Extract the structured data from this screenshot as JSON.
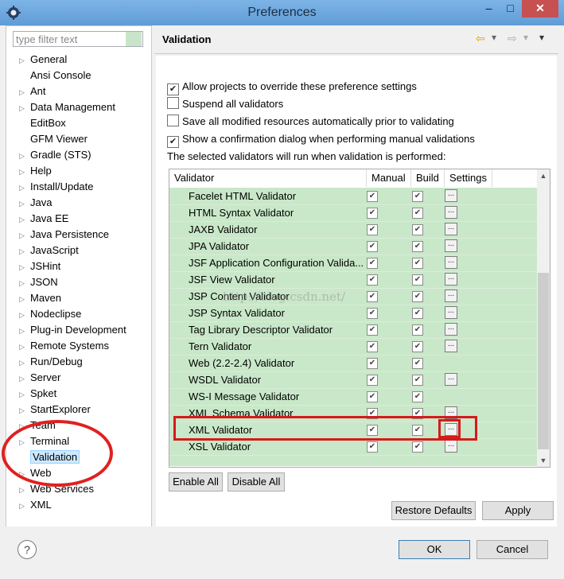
{
  "window": {
    "title": "Preferences",
    "minimize_label": "–",
    "maximize_label": "□",
    "close_label": "✕"
  },
  "filter": {
    "placeholder": "type filter text"
  },
  "tree": [
    {
      "label": "General",
      "arrow": "▷"
    },
    {
      "label": "Ansi Console",
      "arrow": ""
    },
    {
      "label": "Ant",
      "arrow": "▷"
    },
    {
      "label": "Data Management",
      "arrow": "▷"
    },
    {
      "label": "EditBox",
      "arrow": ""
    },
    {
      "label": "GFM Viewer",
      "arrow": ""
    },
    {
      "label": "Gradle (STS)",
      "arrow": "▷"
    },
    {
      "label": "Help",
      "arrow": "▷"
    },
    {
      "label": "Install/Update",
      "arrow": "▷"
    },
    {
      "label": "Java",
      "arrow": "▷"
    },
    {
      "label": "Java EE",
      "arrow": "▷"
    },
    {
      "label": "Java Persistence",
      "arrow": "▷"
    },
    {
      "label": "JavaScript",
      "arrow": "▷"
    },
    {
      "label": "JSHint",
      "arrow": "▷"
    },
    {
      "label": "JSON",
      "arrow": "▷"
    },
    {
      "label": "Maven",
      "arrow": "▷"
    },
    {
      "label": "Nodeclipse",
      "arrow": "▷"
    },
    {
      "label": "Plug-in Development",
      "arrow": "▷"
    },
    {
      "label": "Remote Systems",
      "arrow": "▷"
    },
    {
      "label": "Run/Debug",
      "arrow": "▷"
    },
    {
      "label": "Server",
      "arrow": "▷"
    },
    {
      "label": "Spket",
      "arrow": "▷"
    },
    {
      "label": "StartExplorer",
      "arrow": "▷"
    },
    {
      "label": "Team",
      "arrow": "▷"
    },
    {
      "label": "Terminal",
      "arrow": "▷"
    },
    {
      "label": "Validation",
      "arrow": ""
    },
    {
      "label": "Web",
      "arrow": "▷"
    },
    {
      "label": "Web Services",
      "arrow": "▷"
    },
    {
      "label": "XML",
      "arrow": "▷"
    }
  ],
  "page": {
    "title": "Validation",
    "back_icon": "⇦",
    "forward_icon": "⇨",
    "menu_icon": "▾",
    "options": [
      {
        "label": "Allow projects to override these preference settings",
        "checked": true
      },
      {
        "label": "Suspend all validators",
        "checked": false
      },
      {
        "label": "Save all modified resources automatically prior to validating",
        "checked": false
      },
      {
        "label": "Show a confirmation dialog when performing manual validations",
        "checked": true
      }
    ],
    "info": "The selected validators will run when validation is performed:",
    "columns": {
      "validator": "Validator",
      "manual": "Manual",
      "build": "Build",
      "settings": "Settings"
    },
    "validators": [
      {
        "name": "Facelet HTML Validator",
        "manual": true,
        "build": true,
        "settings": true
      },
      {
        "name": "HTML Syntax Validator",
        "manual": true,
        "build": true,
        "settings": true
      },
      {
        "name": "JAXB Validator",
        "manual": true,
        "build": true,
        "settings": true
      },
      {
        "name": "JPA Validator",
        "manual": true,
        "build": true,
        "settings": true
      },
      {
        "name": "JSF Application Configuration Valida...",
        "manual": true,
        "build": true,
        "settings": true
      },
      {
        "name": "JSF View Validator",
        "manual": true,
        "build": true,
        "settings": true
      },
      {
        "name": "JSP Content Validator",
        "manual": true,
        "build": true,
        "settings": true
      },
      {
        "name": "JSP Syntax Validator",
        "manual": true,
        "build": true,
        "settings": true
      },
      {
        "name": "Tag Library Descriptor Validator",
        "manual": true,
        "build": true,
        "settings": true
      },
      {
        "name": "Tern Validator",
        "manual": true,
        "build": true,
        "settings": true
      },
      {
        "name": "Web (2.2-2.4) Validator",
        "manual": true,
        "build": true,
        "settings": false
      },
      {
        "name": "WSDL Validator",
        "manual": true,
        "build": true,
        "settings": true
      },
      {
        "name": "WS-I Message Validator",
        "manual": true,
        "build": true,
        "settings": false
      },
      {
        "name": "XML Schema Validator",
        "manual": true,
        "build": true,
        "settings": true
      },
      {
        "name": "XML Validator",
        "manual": true,
        "build": true,
        "settings": true
      },
      {
        "name": "XSL Validator",
        "manual": true,
        "build": true,
        "settings": true
      }
    ],
    "settings_button_label": "...",
    "enable_all": "Enable All",
    "disable_all": "Disable All",
    "restore_defaults": "Restore Defaults",
    "apply": "Apply"
  },
  "footer": {
    "ok": "OK",
    "cancel": "Cancel",
    "help_icon": "?"
  },
  "watermark": "http://blog.csdn.net/"
}
